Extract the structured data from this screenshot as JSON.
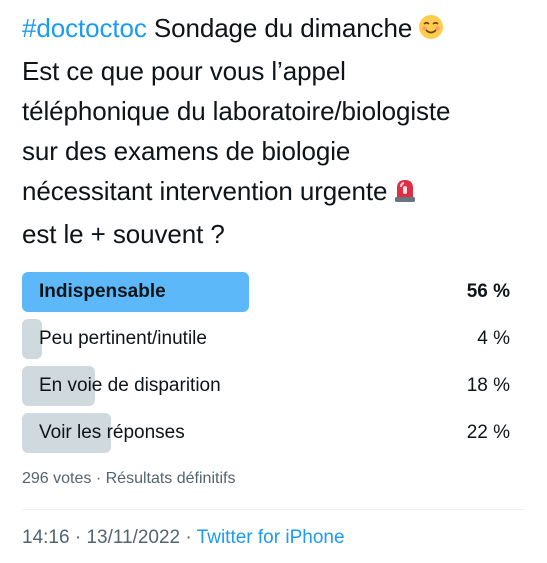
{
  "tweet": {
    "hashtag": "#doctoctoc",
    "line1": " Sondage du dimanche",
    "line2": "Est ce que pour vous l’appel",
    "line3": "téléphonique du laboratoire/biologiste",
    "line4": "sur des examens de biologie",
    "line5": "nécessitant intervention urgente",
    "line6": "est le + souvent ?",
    "emoji_smile": "relieved-face-emoji",
    "emoji_alarm": "police-car-light-emoji"
  },
  "poll": {
    "options": [
      {
        "label": "Indispensable",
        "percent_text": "56 %",
        "percent": 56,
        "winner": true
      },
      {
        "label": "Peu pertinent/inutile",
        "percent_text": "4 %",
        "percent": 4,
        "winner": false
      },
      {
        "label": "En voie de disparition",
        "percent_text": "18 %",
        "percent": 18,
        "winner": false
      },
      {
        "label": "Voir les réponses",
        "percent_text": "22 %",
        "percent": 22,
        "winner": false
      }
    ],
    "votes": "296 votes",
    "separator": " · ",
    "status": "Résultats définitifs"
  },
  "meta": {
    "time": "14:16",
    "separator1": " · ",
    "date": "13/11/2022",
    "separator2": " · ",
    "source": "Twitter for iPhone"
  },
  "colors": {
    "accent": "#1d9bf0",
    "winner_bar": "#5cb8f8",
    "bar": "#cfd9de",
    "text": "#0f1419",
    "secondary": "#536471"
  }
}
